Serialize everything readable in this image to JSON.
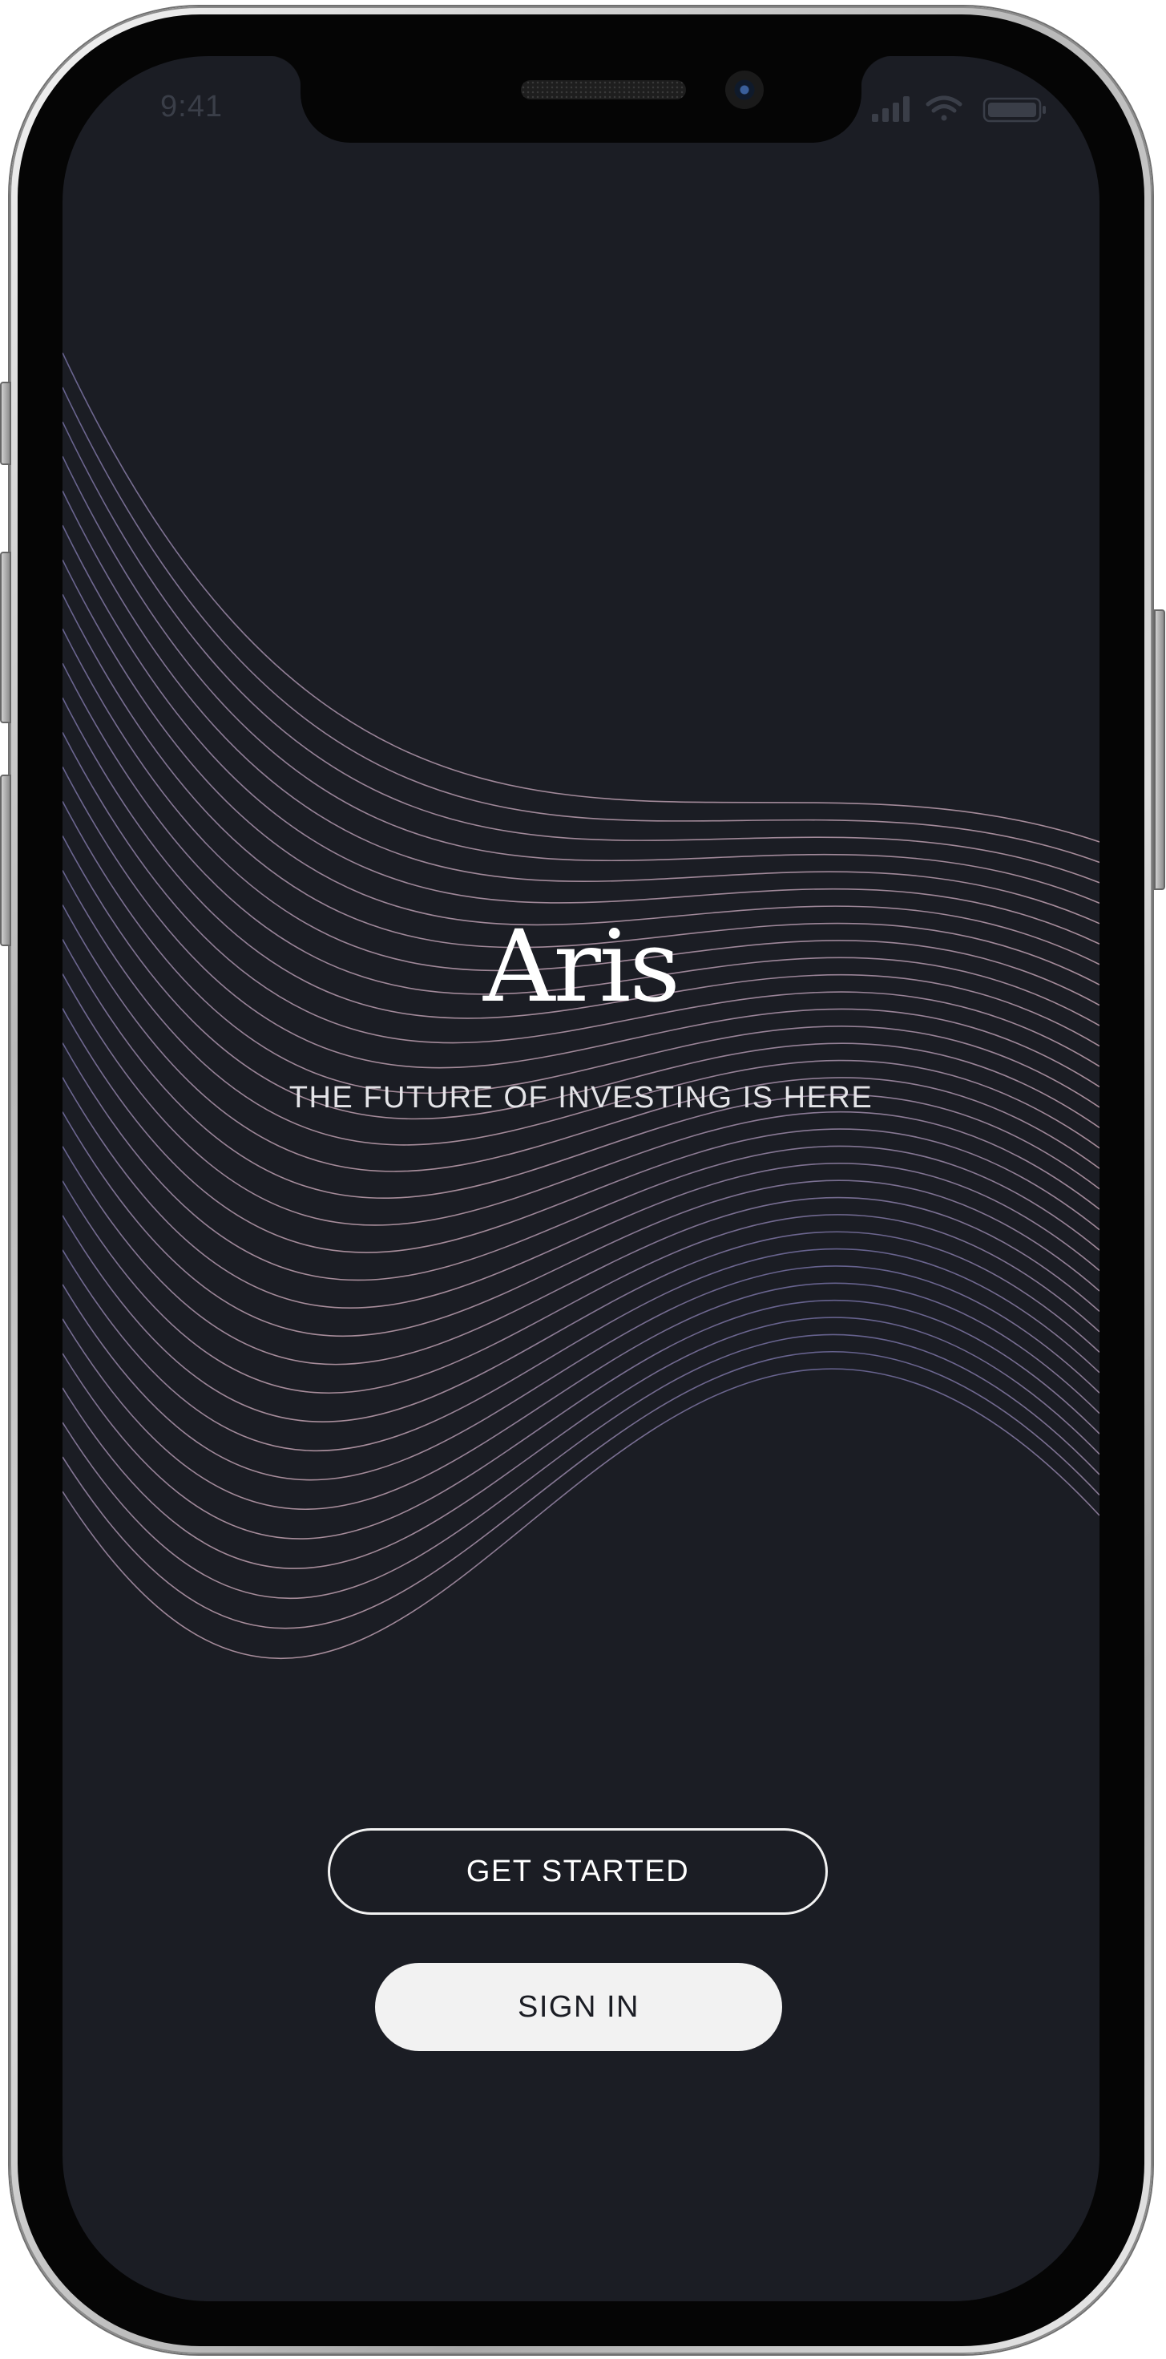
{
  "status_bar": {
    "time": "9:41",
    "icons": [
      "cellular-signal-icon",
      "wifi-icon",
      "battery-icon"
    ]
  },
  "splash": {
    "brand": "Aris",
    "tagline": "THE FUTURE OF INVESTING IS HERE"
  },
  "actions": {
    "get_started_label": "GET STARTED",
    "sign_in_label": "SIGN IN"
  },
  "colors": {
    "background": "#1b1d24",
    "wave_start": "#6f6a9a",
    "wave_end": "#b89aa8",
    "text": "#ffffff",
    "button_fill": "#f2f2f2"
  }
}
